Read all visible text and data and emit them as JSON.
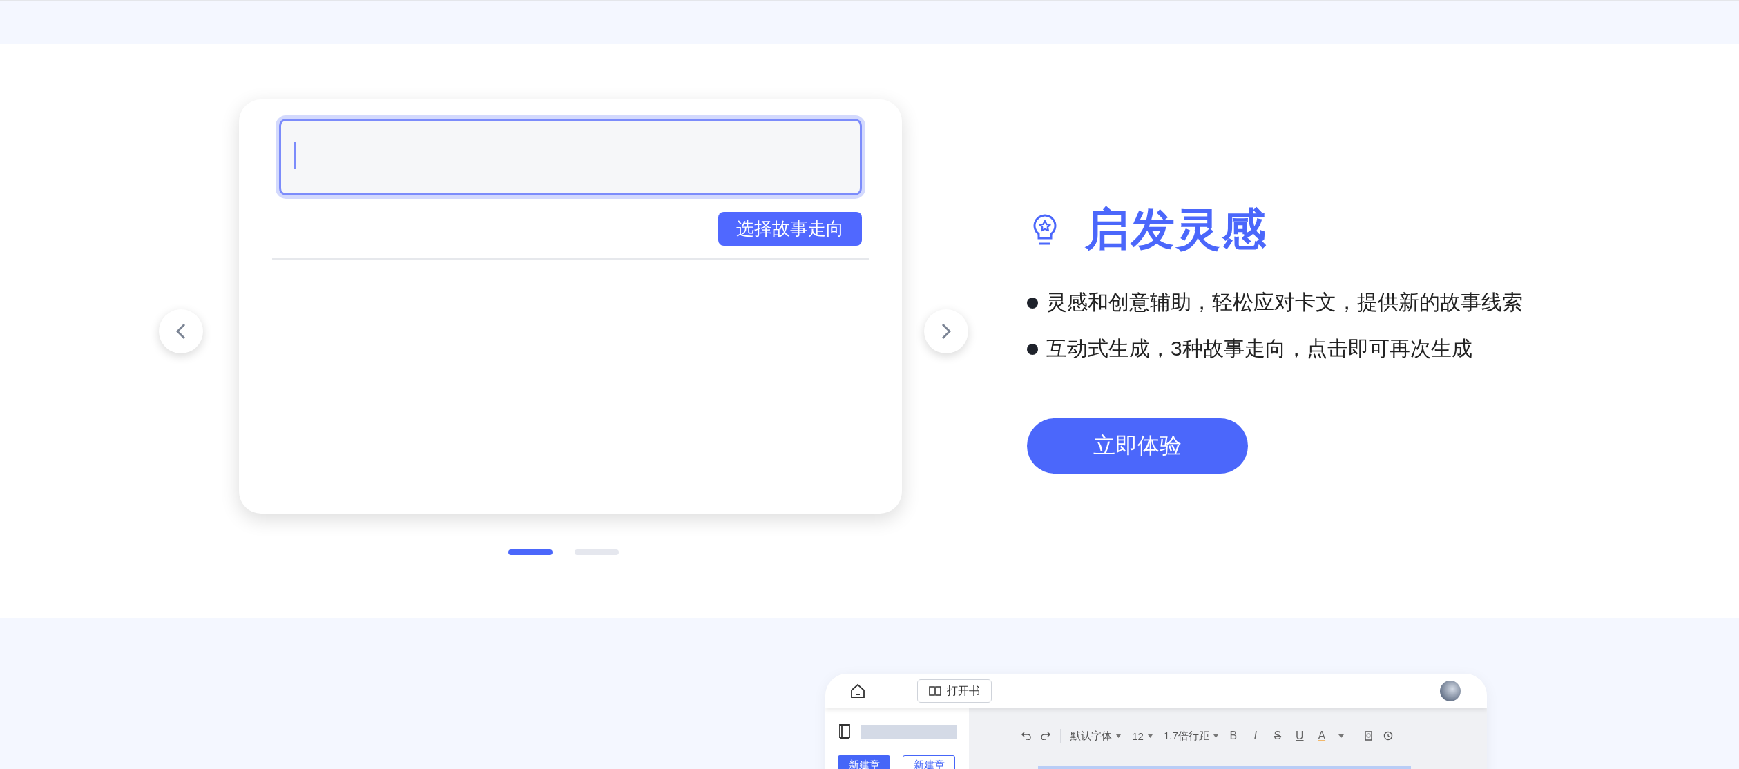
{
  "carousel": {
    "action_button": "选择故事走向",
    "dots": [
      {
        "selected": true
      },
      {
        "selected": false
      }
    ]
  },
  "feature": {
    "title": "启发灵感",
    "bullets": [
      "灵感和创意辅助，轻松应对卡文，提供新的故事线索",
      "互动式生成，3种故事走向，点击即可再次生成"
    ],
    "cta": "立即体验"
  },
  "editor_preview": {
    "open_book": "打开书",
    "sidebar_buttons": [
      {
        "label": "新建章",
        "kind": "primary"
      },
      {
        "label": "新建章",
        "kind": "outline"
      }
    ],
    "dropdowns": [
      "默认字体",
      "12",
      "1.7倍行距"
    ],
    "format_buttons": [
      {
        "label": "B",
        "kind": "bold"
      },
      {
        "label": "I",
        "kind": "italic"
      },
      {
        "label": "S",
        "kind": "strike"
      },
      {
        "label": "U",
        "kind": "underline"
      },
      {
        "label": "A",
        "kind": "color"
      }
    ]
  }
}
